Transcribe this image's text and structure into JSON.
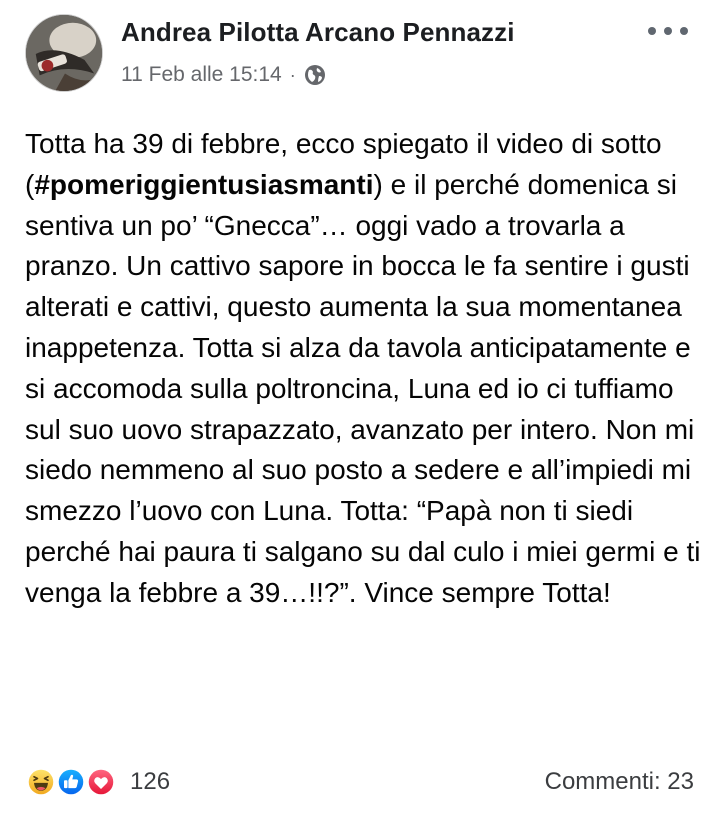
{
  "post": {
    "author": "Andrea Pilotta Arcano Pennazzi",
    "timestamp": "11 Feb alle 15:14",
    "meta_separator": "·",
    "visibility_icon": "globe-icon",
    "avatar_icon": "profile-avatar",
    "more_icon": "more-options-icon",
    "body": {
      "part1": "Totta ha 39 di febbre, ecco spiegato il video di sotto (",
      "hashtag": "#pomeriggientusiasmanti",
      "part2": ") e il perché domenica si sentiva un po’ “Gnecca”… oggi vado a trovarla a pranzo. Un cattivo sapore in bocca le fa sentire i gusti alterati e cattivi, questo aumenta la sua momentanea inappetenza. Totta si alza da tavola anticipatamente e si accomoda sulla poltroncina, Luna ed io ci tuffiamo sul suo uovo strapazzato, avanzato per intero. Non mi siedo nemmeno al suo posto a sedere e all’impiedi mi smezzo l’uovo con Luna. Totta: “Papà non ti siedi perché hai paura ti salgano su dal culo i miei germi e ti venga la febbre a 39…!!?”. Vince sempre Totta!"
    }
  },
  "reactions": {
    "icons": [
      "haha-reaction-icon",
      "like-reaction-icon",
      "love-reaction-icon"
    ],
    "count": "126",
    "comments": "Commenti: 23"
  },
  "colors": {
    "text": "#050505",
    "secondary": "#65676b",
    "like_blue": "#1877f2",
    "love_red": "#f33e58",
    "haha_yellow": "#f7b125"
  }
}
